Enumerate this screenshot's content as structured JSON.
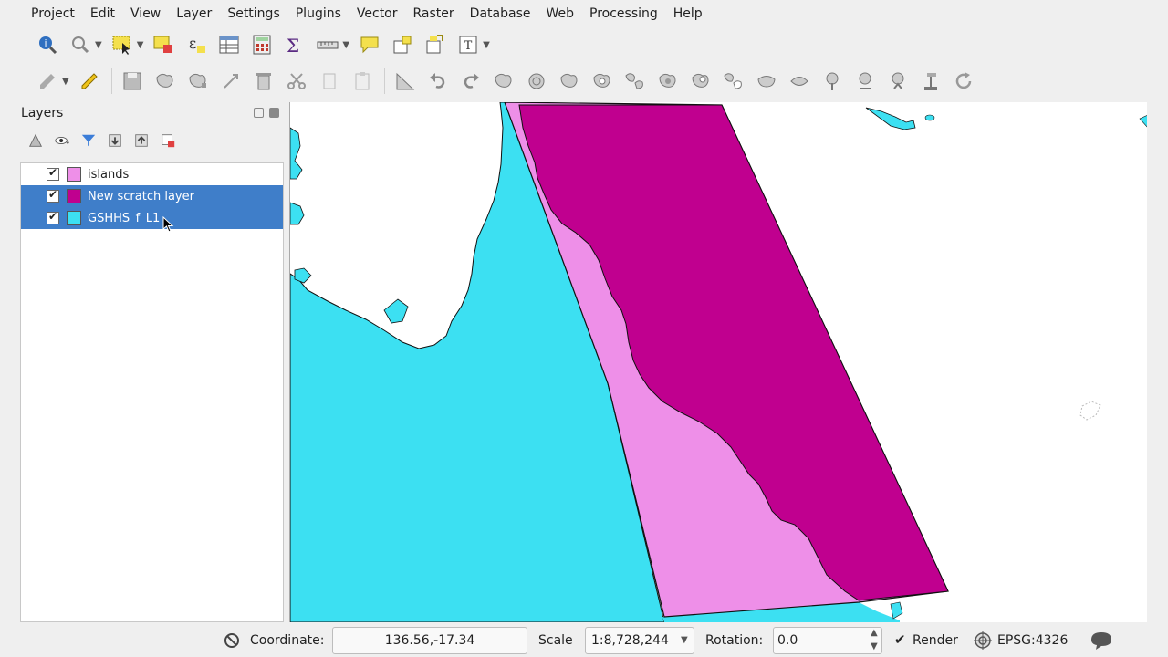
{
  "menu": [
    "Project",
    "Edit",
    "View",
    "Layer",
    "Settings",
    "Plugins",
    "Vector",
    "Raster",
    "Database",
    "Web",
    "Processing",
    "Help"
  ],
  "layers_panel": {
    "title": "Layers",
    "layers": [
      {
        "name": "islands",
        "color": "#ee8fe8",
        "checked": true,
        "selected": false
      },
      {
        "name": "New scratch layer",
        "color": "#c0008f",
        "checked": true,
        "selected": true
      },
      {
        "name": "GSHHS_f_L1",
        "color": "#3ce0f2",
        "checked": true,
        "selected": true
      }
    ]
  },
  "status": {
    "coordinate_label": "Coordinate:",
    "coordinate_value": "136.56,-17.34",
    "scale_label": "Scale",
    "scale_value": "1:8,728,244",
    "rotation_label": "Rotation:",
    "rotation_value": "0.0",
    "render_label": "Render",
    "crs": "EPSG:4326"
  },
  "colors": {
    "land": "#3ce0f2",
    "islands": "#ee8fe8",
    "scratch": "#c0008f",
    "selection": "#3f7ec9"
  },
  "icons": {
    "toolbar1": [
      "identify-icon",
      "zoom-icon",
      "select-icon",
      "deselect-icon",
      "expression-icon",
      "attribute-table-icon",
      "field-calc-icon",
      "statistics-icon",
      "measure-icon",
      "annotation-icon",
      "add-text-icon",
      "move-label-icon",
      "text-annotation-icon"
    ],
    "toolbar2": [
      "edit-icon",
      "pencil-icon",
      "save-icon",
      "add-feature-icon",
      "node-tool-icon",
      "move-feature-icon",
      "delete-icon",
      "cut-icon",
      "copy-icon",
      "paste-icon",
      "digitize-icon",
      "undo-icon",
      "redo-icon",
      "offset-icon",
      "rotate-icon",
      "simplify-icon",
      "add-ring-icon",
      "add-part-icon",
      "fill-ring-icon",
      "delete-ring-icon",
      "delete-part-icon",
      "reshape-icon",
      "offset-curve-icon",
      "split-icon",
      "split-parts-icon",
      "merge-icon",
      "merge-attr-icon",
      "rotate-point-icon",
      "refresh-icon"
    ]
  }
}
